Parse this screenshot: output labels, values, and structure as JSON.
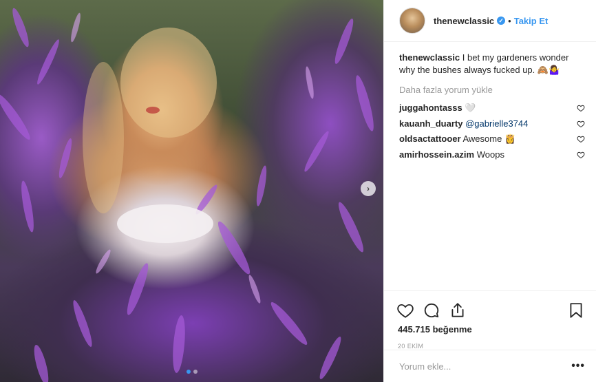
{
  "header": {
    "username": "thenewclassic",
    "verified_glyph": "✓",
    "separator": "•",
    "follow_label": "Takip Et"
  },
  "caption": {
    "username": "thenewclassic",
    "text": "I bet my gardeners wonder why the bushes always fucked up. 🙈🤷‍♀️"
  },
  "load_more_label": "Daha fazla yorum yükle",
  "comments": [
    {
      "username": "juggahontasss",
      "text": "🤍",
      "mention": ""
    },
    {
      "username": "kauanh_duarty",
      "text": "",
      "mention": "@gabrielle3744"
    },
    {
      "username": "oldsactattooer",
      "text": "Awesome 👸",
      "mention": ""
    },
    {
      "username": "amirhossein.azim",
      "text": "Woops",
      "mention": ""
    }
  ],
  "likes": "445.715 beğenme",
  "date": "20 EKİM",
  "add_comment": {
    "placeholder": "Yorum ekle...",
    "more_label": "•••"
  },
  "media": {
    "next_arrow": "›",
    "page_count": 2,
    "active_page": 1
  },
  "colors": {
    "accent": "#3897f0",
    "text": "#262626",
    "muted": "#999999",
    "border": "#efefef"
  },
  "icons": [
    "heart-icon",
    "comment-icon",
    "share-icon",
    "bookmark-icon",
    "verified-icon",
    "chevron-right-icon"
  ]
}
